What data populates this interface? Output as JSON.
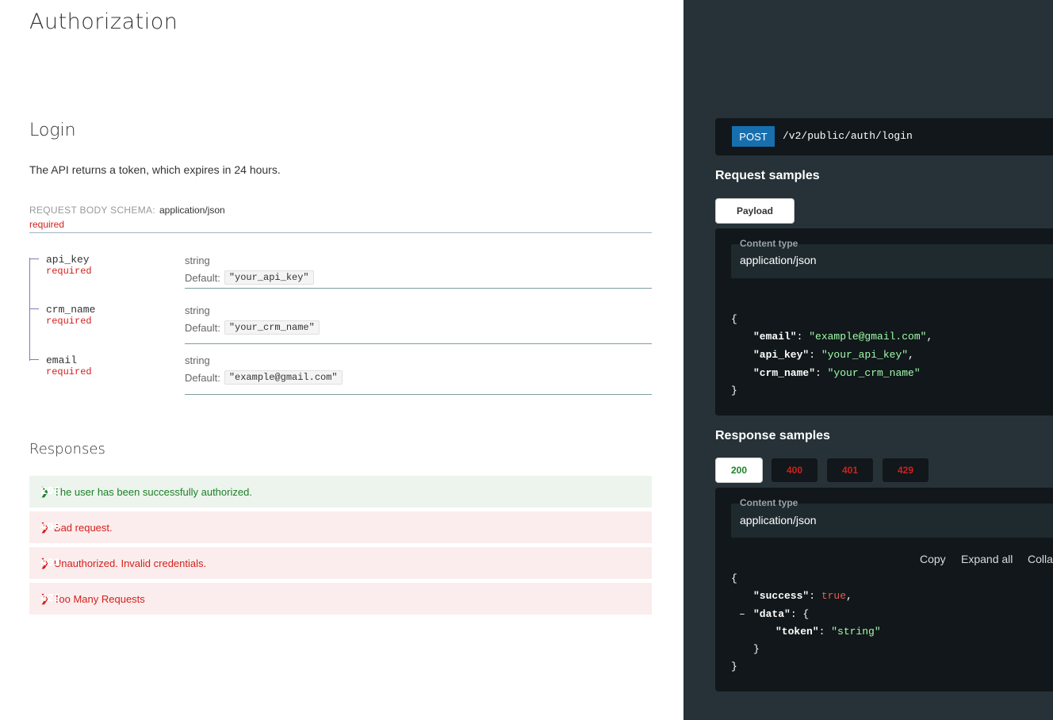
{
  "left": {
    "title": "Authorization",
    "op_title": "Login",
    "description": "The API returns a token, which expires in 24 hours.",
    "schema_label": "REQUEST BODY SCHEMA:",
    "schema_value": "application/json",
    "schema_required": "required",
    "params": [
      {
        "name": "api_key",
        "required": "required",
        "type": "string",
        "default_label": "Default:",
        "default": "\"your_api_key\""
      },
      {
        "name": "crm_name",
        "required": "required",
        "type": "string",
        "default_label": "Default:",
        "default": "\"your_crm_name\""
      },
      {
        "name": "email",
        "required": "required",
        "type": "string",
        "default_label": "Default:",
        "default": "\"example@gmail.com\""
      }
    ],
    "responses_title": "Responses",
    "responses": [
      {
        "code": "200",
        "text": "The user has been successfully authorized."
      },
      {
        "code": "400",
        "text": "Bad request."
      },
      {
        "code": "401",
        "text": "Unauthorized. Invalid credentials."
      },
      {
        "code": "429",
        "text": "Too Many Requests"
      }
    ],
    "icons": {
      "chevron": "chevron-right-icon"
    }
  },
  "right": {
    "method": "POST",
    "path": "/v2/public/auth/login",
    "request_title": "Request samples",
    "request_tab": "Payload",
    "content_type_label": "Content type",
    "content_type_value": "application/json",
    "request_body": {
      "open": "{",
      "close": "}",
      "email_key": "\"email\"",
      "email_val": "\"example@gmail.com\"",
      "api_key_key": "\"api_key\"",
      "api_key_val": "\"your_api_key\"",
      "crm_key": "\"crm_name\"",
      "crm_val": "\"your_crm_name\""
    },
    "response_title": "Response samples",
    "response_tabs": [
      "200",
      "400",
      "401",
      "429"
    ],
    "tools": {
      "copy": "Copy",
      "expand": "Expand all",
      "collapse": "Colla"
    },
    "response_body": {
      "open": "{",
      "close": "}",
      "success_key": "\"success\"",
      "success_val": "true",
      "collapse_toggle": "–",
      "data_key": "\"data\"",
      "data_open": "{",
      "token_key": "\"token\"",
      "token_val": "\"string\"",
      "data_close": "}"
    }
  },
  "colors": {
    "post": "#186fae",
    "success": "#1d8127",
    "error": "#d41f1c",
    "string": "#a0fbaa",
    "dark_bg": "#263238",
    "code_bg": "#11171a"
  }
}
